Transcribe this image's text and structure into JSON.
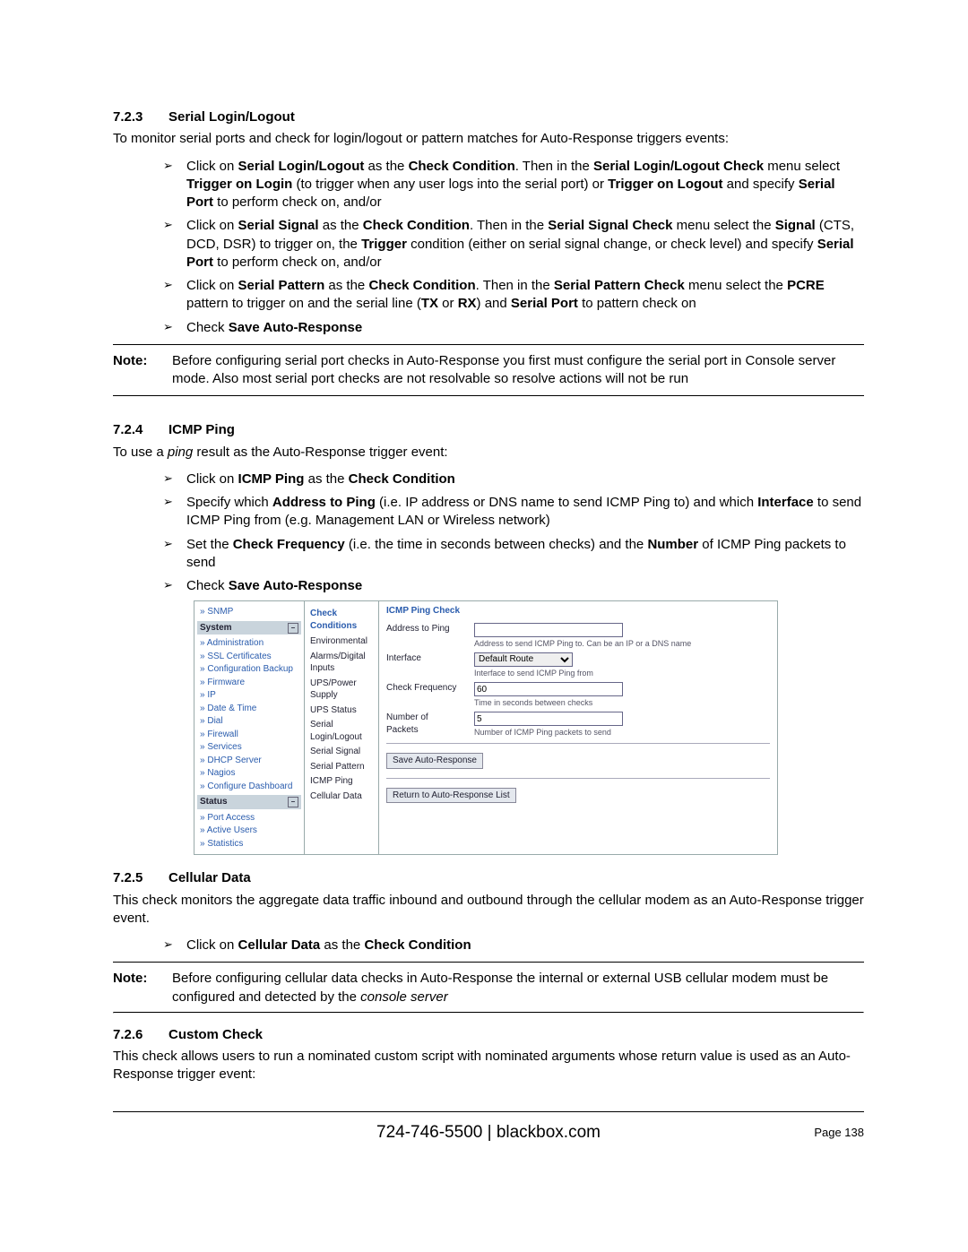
{
  "sections": {
    "serial": {
      "num": "7.2.3",
      "title": "Serial Login/Logout",
      "intro": "To monitor serial ports and check for login/logout or pattern matches for Auto-Response triggers events:",
      "steps": {
        "s1_a": "Click on ",
        "s1_b": "Serial Login/Logout",
        "s1_c": " as the ",
        "s1_d": "Check Condition",
        "s1_e": ". Then in the ",
        "s1_f": "Serial Login/Logout Check",
        "s1_g": " menu select ",
        "s1_h": "Trigger on Login",
        "s1_i": " (to trigger when any user logs into the serial port) or ",
        "s1_j": "Trigger on Logout",
        "s1_k": " and specify  ",
        "s1_l": "Serial Port",
        "s1_m": " to perform check on, and/or",
        "s2_a": "Click on ",
        "s2_b": "Serial Signal",
        "s2_c": " as the ",
        "s2_d": "Check Condition",
        "s2_e": ". Then in the ",
        "s2_f": "Serial Signal Check",
        "s2_g": " menu select the ",
        "s2_h": "Signal",
        "s2_i": " (CTS, DCD, DSR) to trigger on, the ",
        "s2_j": "Trigger",
        "s2_k": " condition (either on serial signal change, or  check level) and specify  ",
        "s2_l": "Serial Port",
        "s2_m": " to perform check on, and/or",
        "s3_a": "Click on ",
        "s3_b": "Serial Pattern",
        "s3_c": " as the ",
        "s3_d": "Check Condition",
        "s3_e": ". Then in the ",
        "s3_f": "Serial Pattern Check",
        "s3_g": " menu select the ",
        "s3_h": "PCRE",
        "s3_i": " pattern to trigger on and the serial line (",
        "s3_j": "TX",
        "s3_k": " or  ",
        "s3_l": "RX",
        "s3_m": ") and ",
        "s3_n": "Serial Port",
        "s3_o": " to pattern check on",
        "s4_a": "Check ",
        "s4_b": "Save Auto-Response"
      },
      "note_label": "Note:",
      "note": "Before configuring serial port checks in Auto-Response you first must configure the serial port in Console server mode. Also most serial port checks are not resolvable so resolve actions will not be run"
    },
    "icmp": {
      "num": "7.2.4",
      "title": "ICMP Ping",
      "intro_a": "To use a ",
      "intro_b": "ping",
      "intro_c": " result as the Auto-Response trigger event:",
      "steps": {
        "s1_a": "Click on ",
        "s1_b": "ICMP Ping",
        "s1_c": " as the ",
        "s1_d": "Check Condition",
        "s2_a": "Specify which ",
        "s2_b": "Address to Ping",
        "s2_c": " (i.e. IP address or DNS name to send ICMP Ping to) and which ",
        "s2_d": "Interface",
        "s2_e": " to send ICMP Ping from (e.g. Management LAN or Wireless network)",
        "s3_a": "Set the ",
        "s3_b": "Check Frequency",
        "s3_c": " (i.e. the time in seconds between checks) and the ",
        "s3_d": "Number",
        "s3_e": " of ICMP Ping packets to send",
        "s4_a": "Check ",
        "s4_b": "Save Auto-Response"
      }
    },
    "cell": {
      "num": "7.2.5",
      "title": "Cellular Data",
      "intro": "This check monitors the aggregate data traffic inbound and outbound through the cellular modem as an Auto-Response trigger event.",
      "step_a": "Click on ",
      "step_b": "Cellular Data",
      "step_c": " as the ",
      "step_d": "Check Condition",
      "note_label": "Note:",
      "note_a": "Before configuring cellular data checks in Auto-Response the internal or external USB cellular modem must be configured and detected by the ",
      "note_b": "console server"
    },
    "custom": {
      "num": "7.2.6",
      "title": "Custom Check",
      "intro": "This check allows users to run a nominated custom script with nominated arguments whose return value is used as an Auto-Response trigger event:"
    }
  },
  "shot": {
    "snmp": "SNMP",
    "system_hdr": "System",
    "system": [
      "Administration",
      "SSL Certificates",
      "Configuration Backup",
      "Firmware",
      "IP",
      "Date & Time",
      "Dial",
      "Firewall",
      "Services",
      "DHCP Server",
      "Nagios",
      "Configure Dashboard"
    ],
    "status_hdr": "Status",
    "status": [
      "Port Access",
      "Active Users",
      "Statistics"
    ],
    "cc_title": "Check Conditions",
    "cc": [
      "Environmental",
      "Alarms/Digital Inputs",
      "UPS/Power Supply",
      "UPS Status",
      "Serial Login/Logout",
      "Serial Signal",
      "Serial Pattern",
      "ICMP Ping",
      "Cellular Data"
    ],
    "form_title": "ICMP Ping Check",
    "f_addr": "Address to Ping",
    "f_addr_hint": "Address to send ICMP Ping to. Can be an IP or a DNS name",
    "f_if": "Interface",
    "f_if_opt": "Default Route",
    "f_if_hint": "Interface to send ICMP Ping from",
    "f_freq": "Check Frequency",
    "f_freq_val": "60",
    "f_freq_hint": "Time in seconds between checks",
    "f_pkts_a": "Number of",
    "f_pkts_b": "Packets",
    "f_pkts_val": "5",
    "f_pkts_hint": "Number of ICMP Ping packets to send",
    "btn_save": "Save Auto-Response",
    "btn_return": "Return to Auto-Response List"
  },
  "footer": {
    "center": "724-746-5500 | blackbox.com",
    "page": "Page 138"
  }
}
